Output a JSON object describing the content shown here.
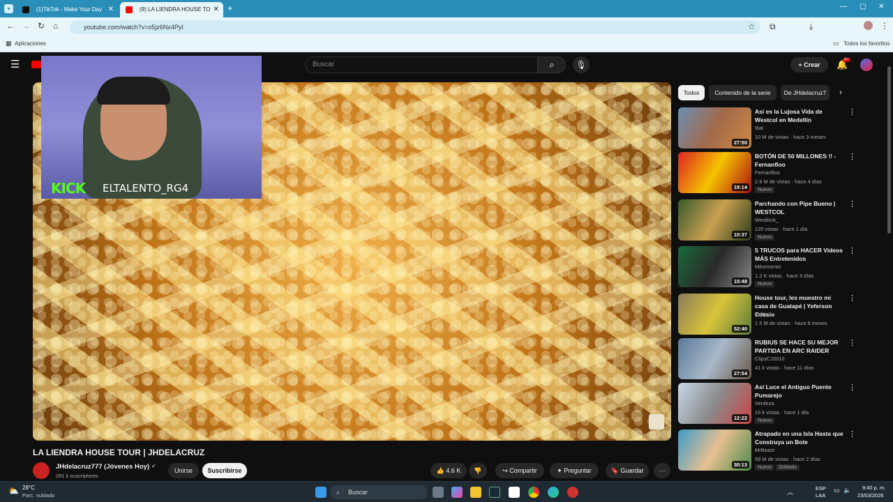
{
  "browser": {
    "tabs": [
      {
        "label": "(1)TikTok - Make Your Day"
      },
      {
        "label": "(9) LA LIENDRA HOUSE TO"
      }
    ],
    "url": "youtube.com/watch?v=o5jz6Nx4PyI",
    "bookmarks": {
      "apps": "Aplicaciones",
      "all": "Todos los favoritos"
    }
  },
  "youtube": {
    "search_placeholder": "Buscar",
    "create_label": "Crear",
    "notif_count": "9+",
    "overlay": {
      "kick": "KICK",
      "name": "ELTALENTO_RG4"
    },
    "video": {
      "title": "LA LIENDRA HOUSE TOUR | JHDELACRUZ",
      "channel": "JHdelacruz777 (Jóvenes Hoy)",
      "subscribers": "291 k suscriptores",
      "join": "Unirse",
      "subscribe": "Suscribirse",
      "likes": "4.6 K",
      "share": "Compartir",
      "ask": "Preguntar",
      "save": "Guardar"
    },
    "chips": [
      "Todos",
      "Contenido de la serie",
      "De JHdelacruz7"
    ],
    "recs": [
      {
        "title": "Así es la Lujosa Vida de Westcol en Medellín",
        "channel": "Ibai",
        "meta": "10 M de vistas · hace 3 meses",
        "duration": "27:50",
        "badge": ""
      },
      {
        "title": "BOTÓN DE 50 MILLONES !! - Fernanfloo",
        "channel": "Fernanfloo",
        "meta": "2.9 M de vistas · hace 4 días",
        "duration": "19:14",
        "badge": "Nuevo"
      },
      {
        "title": "Parchando con Pipe Bueno | WESTCOL",
        "channel": "Westkick_",
        "meta": "120 vistas · hace 1 día",
        "duration": "10:37",
        "badge": "Nuevo"
      },
      {
        "title": "5 TRUCOS para HACER Videos MÁS Entretenidos",
        "channel": "Mitormento",
        "meta": "1.2 K vistas · hace 3 días",
        "duration": "15:48",
        "badge": "Nuevo"
      },
      {
        "title": "House tour, les muestro mi casa de Guatapé | Yeferson Cossio",
        "channel": "Yefito",
        "meta": "1.5 M de vistas · hace 8 meses",
        "duration": "52:40",
        "badge": ""
      },
      {
        "title": "RUBIUS SE HACE SU MEJOR PARTIDA EN ARC RAIDER",
        "channel": "ClipsCJ2010",
        "meta": "41 k vistas · hace 11 días",
        "duration": "27:54",
        "badge": ""
      },
      {
        "title": "Así Luce el Antiguo Puente Pumarejo",
        "channel": "Verdeza",
        "meta": "15 k vistas · hace 1 día",
        "duration": "12:22",
        "badge": "Nuevo"
      },
      {
        "title": "Atrapado en una Isla Hasta que Construya un Bote",
        "channel": "MrBeast",
        "meta": "59 M de vistas · hace 2 días",
        "duration": "30:13",
        "badge": "Nuevo"
      }
    ],
    "rec_extra_badge": "Doblado"
  },
  "taskbar": {
    "temp": "28°C",
    "weather": "Parc. nublado",
    "search": "Buscar",
    "lang1": "ESP",
    "lang2": "LAA",
    "time": "9:40 p. m.",
    "date": "23/03/2026"
  },
  "colors": {
    "accent": "#2a8fb8",
    "bg": "#0f0f0f",
    "kick_green": "#53fc18",
    "yt_red": "#ff0000"
  }
}
